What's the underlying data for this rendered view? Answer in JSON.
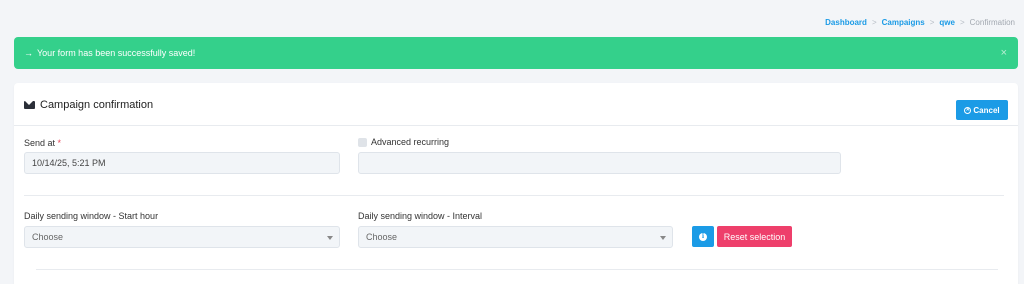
{
  "breadcrumb": {
    "items": [
      "Dashboard",
      "Campaigns",
      "qwe"
    ],
    "current": "Confirmation",
    "separator": ">"
  },
  "alert": {
    "arrow": "→",
    "message": "Your form has been successfully saved!",
    "close": "×",
    "color": "#34d08b"
  },
  "card": {
    "title": "Campaign confirmation",
    "title_icon": "envelope-icon",
    "cancel_label": "Cancel",
    "cancel_icon": "times-circle-icon"
  },
  "form": {
    "send_at": {
      "label": "Send at",
      "required_mark": "*",
      "value": "10/14/25, 5:21 PM"
    },
    "advanced_recurring": {
      "label": "Advanced recurring",
      "checked": false,
      "value": ""
    },
    "start_hour": {
      "label": "Daily sending window - Start hour",
      "value": "Choose"
    },
    "interval": {
      "label": "Daily sending window - Interval",
      "value": "Choose"
    },
    "info_icon": "info-icon",
    "reset_label": "Reset selection"
  },
  "colors": {
    "primary": "#1b9be6",
    "success": "#34d08b",
    "danger": "#ee3f6b"
  }
}
